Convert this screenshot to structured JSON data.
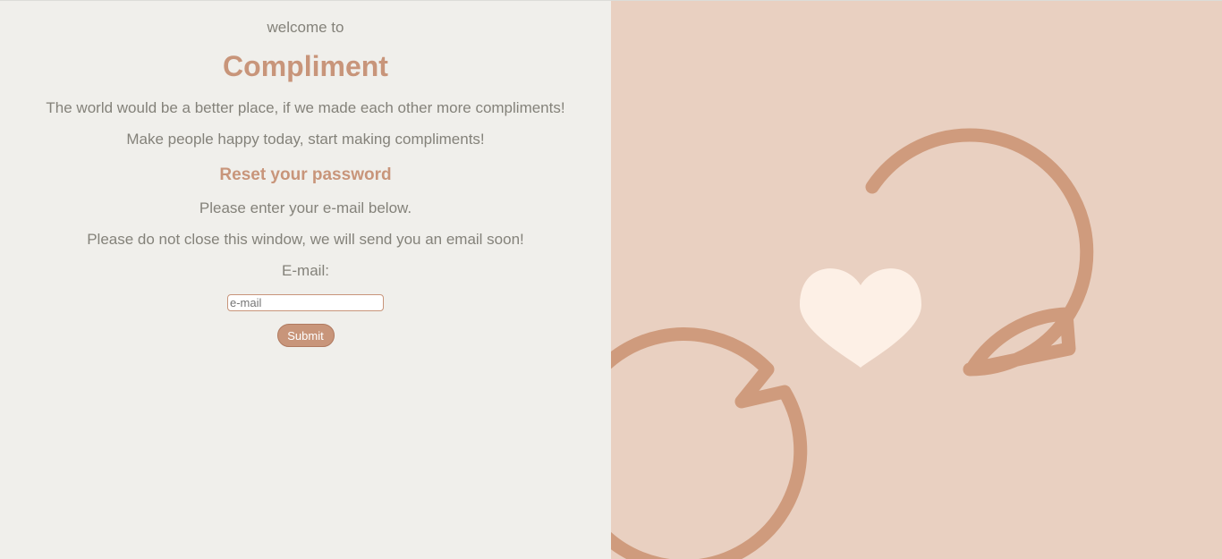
{
  "intro": {
    "welcome": "welcome to",
    "brand": "Compliment",
    "tagline": "The world would be a better place, if we made each other more compliments!",
    "tagline2": "Make people happy today, start making compliments!"
  },
  "reset": {
    "title": "Reset your password",
    "instruction": "Please enter your e-mail below.",
    "notice": "Please do not close this window, we will send you an email soon!",
    "email_label": "E-mail:",
    "email_placeholder": "e-mail",
    "email_value": "",
    "submit_label": "Submit"
  },
  "illustration": {
    "icon": "chat-bubbles-heart-icon",
    "bubble_color": "#cf9b7d",
    "heart_color": "#fdf0e6",
    "panel_color": "#e9d0c1"
  }
}
